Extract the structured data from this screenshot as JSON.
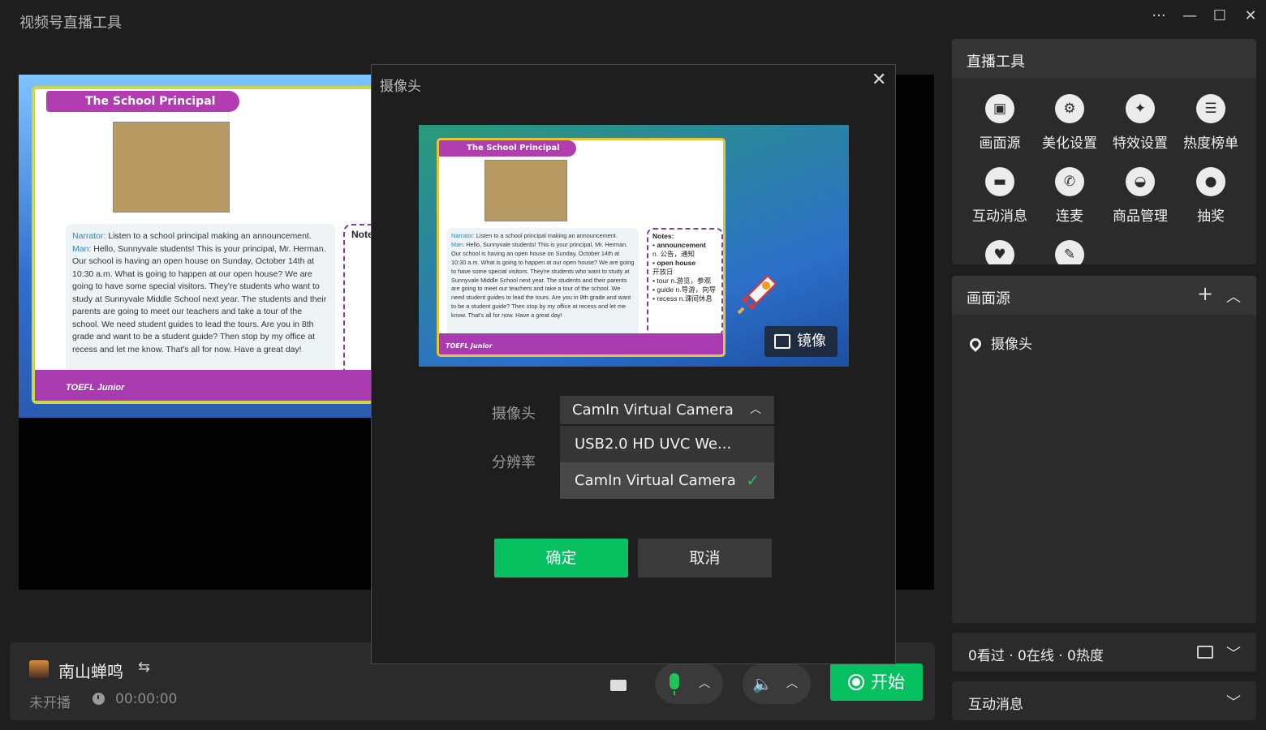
{
  "app": {
    "title": "视频号直播工具"
  },
  "window_controls": {
    "more": "···",
    "minimize": "—",
    "maximize": "☐",
    "close": "✕"
  },
  "slide": {
    "title": "The School Principal",
    "narrator_label": "Narrator:",
    "narrator_text": " Listen to a school principal making an announcement.",
    "man_label": "Man:",
    "man_text": " Hello, Sunnyvale students! This is your principal, Mr. Herman. Our school is having an open house on Sunday, October 14th at 10:30 a.m. What is going to happen at our open house? We are going to have some special visitors. They're students who want to study at Sunnyvale Middle School next year. The students and their parents are going to meet our teachers and take a tour of the school. We need student guides to lead the tours. Are you in 8th grade and want to be a student guide? Then stop by my office at recess and let me know. That's all for now. Have a great day!",
    "notes_title": "Notes:",
    "notes_items": [
      "announcement",
      "n. 公告，通知",
      "open house",
      "开放日",
      "tour n.游览，参观",
      "guide n.导游，向导",
      "recess n.课间休息"
    ],
    "logo": "TOEFL Junior"
  },
  "bottom_bar": {
    "host_name": "南山蝉鸣",
    "switch_icon": "⇆",
    "status": "未开播",
    "timer": "00:00:00",
    "start_label": "开始"
  },
  "tools_panel": {
    "title": "直播工具",
    "items": [
      {
        "label": "画面源",
        "icon": "▣"
      },
      {
        "label": "美化设置",
        "icon": "⚙"
      },
      {
        "label": "特效设置",
        "icon": "✦"
      },
      {
        "label": "热度榜单",
        "icon": "☰"
      },
      {
        "label": "互动消息",
        "icon": "▬"
      },
      {
        "label": "连麦",
        "icon": "✆"
      },
      {
        "label": "商品管理",
        "icon": "◒"
      },
      {
        "label": "抽奖",
        "icon": "●"
      }
    ]
  },
  "source_panel": {
    "title": "画面源",
    "add": "+",
    "collapse": "︿",
    "item": "摄像头"
  },
  "stats_panel": {
    "text": "0看过 · 0在线 · 0热度",
    "expand": "﹀"
  },
  "messages_panel": {
    "title": "互动消息",
    "expand": "﹀"
  },
  "dialog": {
    "title": "摄像头",
    "close": "✕",
    "mirror_label": "镜像",
    "camera_label": "摄像头",
    "resolution_label": "分辨率",
    "selected_camera": "CamIn Virtual Camera",
    "options": [
      "USB2.0 HD UVC We...",
      "CamIn Virtual Camera"
    ],
    "check": "✓",
    "ok": "确定",
    "cancel": "取消"
  }
}
